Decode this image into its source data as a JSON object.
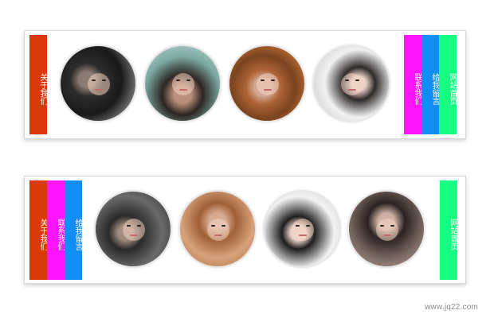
{
  "top_panel": {
    "left_nav": [
      {
        "label": "关于我们",
        "color": "#d9390d"
      }
    ],
    "right_nav": [
      {
        "label": "联系我们",
        "color": "#ff14ff"
      },
      {
        "label": "给我留言",
        "color": "#138cf3"
      },
      {
        "label": "网站首页",
        "color": "#15ff82"
      }
    ],
    "photos": [
      {
        "icon": "portrait-photo-1"
      },
      {
        "icon": "portrait-photo-2"
      },
      {
        "icon": "portrait-photo-3"
      },
      {
        "icon": "portrait-photo-4"
      }
    ]
  },
  "bottom_panel": {
    "left_nav": [
      {
        "label": "关于我们",
        "color": "#d9390d"
      },
      {
        "label": "联系我们",
        "color": "#ff14ff"
      },
      {
        "label": "给我留言",
        "color": "#138cf3"
      }
    ],
    "right_nav": [
      {
        "label": "网站首页",
        "color": "#15ff82"
      }
    ],
    "photos": [
      {
        "icon": "portrait-photo-1"
      },
      {
        "icon": "portrait-photo-2"
      },
      {
        "icon": "portrait-photo-3"
      },
      {
        "icon": "portrait-photo-4"
      }
    ]
  },
  "watermark": "www.jq22.com"
}
